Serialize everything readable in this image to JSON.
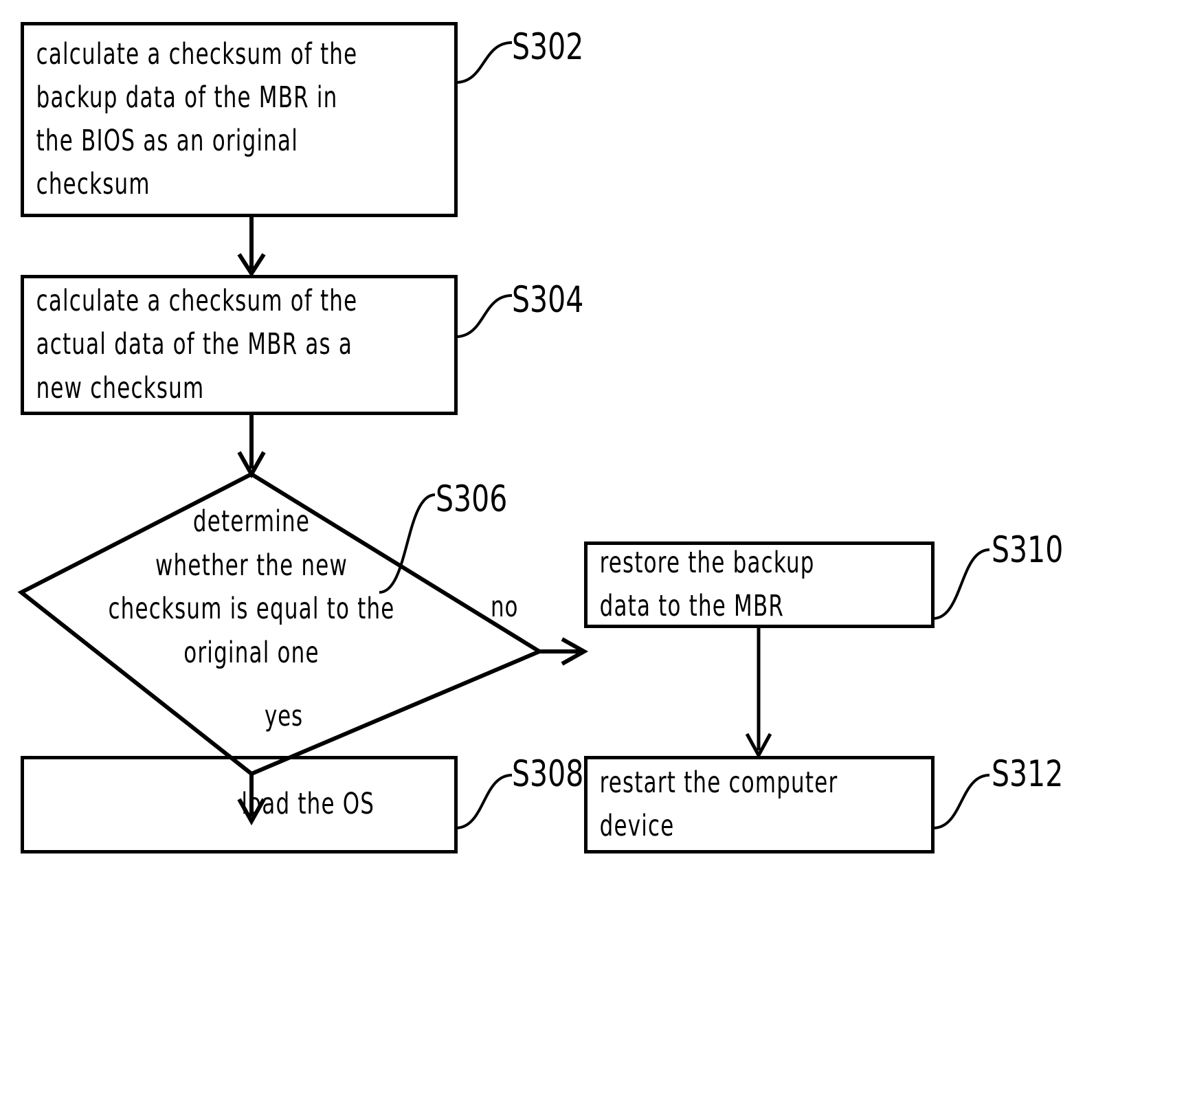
{
  "diagram": {
    "type": "flowchart",
    "title": "",
    "nodes": [
      {
        "id": "S302",
        "shape": "process",
        "ref": "S302",
        "text": "calculate a checksum of the\nbackup data of the MBR in\nthe BIOS as an original\nchecksum"
      },
      {
        "id": "S304",
        "shape": "process",
        "ref": "S304",
        "text": "calculate a checksum of the\nactual data of the MBR as a\nnew checksum"
      },
      {
        "id": "S306",
        "shape": "decision",
        "ref": "S306",
        "text": "determine\nwhether the new\nchecksum is equal to the\noriginal one"
      },
      {
        "id": "S308",
        "shape": "process",
        "ref": "S308",
        "text": "load the OS"
      },
      {
        "id": "S310",
        "shape": "process",
        "ref": "S310",
        "text": "restore the backup\ndata to the MBR"
      },
      {
        "id": "S312",
        "shape": "process",
        "ref": "S312",
        "text": "restart the computer\ndevice"
      }
    ],
    "edges": [
      {
        "from": "S302",
        "to": "S304",
        "label": ""
      },
      {
        "from": "S304",
        "to": "S306",
        "label": ""
      },
      {
        "from": "S306",
        "to": "S308",
        "label": "yes"
      },
      {
        "from": "S306",
        "to": "S310",
        "label": "no"
      },
      {
        "from": "S310",
        "to": "S312",
        "label": ""
      }
    ],
    "branch_labels": {
      "yes": "yes",
      "no": "no"
    },
    "colors": {
      "stroke": "#000000",
      "background": "#ffffff",
      "text": "#000000"
    }
  }
}
